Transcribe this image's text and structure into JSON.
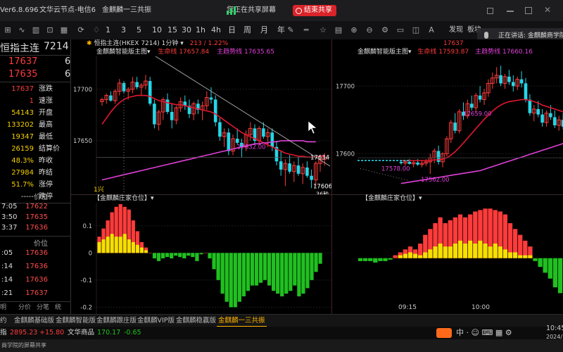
{
  "titlebar": {
    "version": "Ver6.8.696",
    "app_name": "文华云节点-电信6",
    "tab_title": "金麒麟一三共振",
    "share_status": "您正在共享屏幕",
    "end_share": "结束共享"
  },
  "toolbar": {
    "periods": [
      "1",
      "3",
      "5",
      "10",
      "15",
      "30",
      "1h",
      "4h",
      "日",
      "周",
      "月",
      "年"
    ],
    "right_items": [
      "发现",
      "板块"
    ],
    "speaking_label": "正在讲话:",
    "speaking_name": "金麒麟商学院"
  },
  "left_panel": {
    "symbol": "恒指主连",
    "symbol_code_fragment": "7214",
    "bid_price": "17637",
    "bid_fragment": "6",
    "ask_price": "17635",
    "ask_fragment": "6",
    "quote_rows": [
      {
        "value": "17637",
        "label": "涨跌",
        "color": "#ff3b3b"
      },
      {
        "value": "1",
        "label": "速涨",
        "color": "#ff3b3b"
      },
      {
        "value": "54143",
        "label": "开盘",
        "color": "#f5d000"
      },
      {
        "value": "133202",
        "label": "最高",
        "color": "#f5d000"
      },
      {
        "value": "19347",
        "label": "最低",
        "color": "#f5d000"
      },
      {
        "value": "26159",
        "label": "结算价",
        "color": "#f5d000"
      },
      {
        "value": "48.3%",
        "label": "昨收",
        "color": "#f5d000"
      },
      {
        "value": "27984",
        "label": "昨结",
        "color": "#f5d000"
      },
      {
        "value": "51.7%",
        "label": "涨停",
        "color": "#f5d000"
      },
      {
        "value": "-----",
        "label": "跌停",
        "color": "#dddddd"
      }
    ],
    "price_header": "价位",
    "trades_a": [
      {
        "time": "7:05",
        "price": "17622"
      },
      {
        "time": "3:50",
        "price": "17635"
      },
      {
        "time": "3:37",
        "price": "17636"
      }
    ],
    "price_header_2": "价位",
    "trades_b": [
      {
        "time": ":05",
        "price": "17636"
      },
      {
        "time": ":14",
        "price": "17636"
      },
      {
        "time": ":14",
        "price": "17636"
      },
      {
        "time": ":21",
        "price": "17637"
      }
    ],
    "bottom_tabs": [
      "明",
      "分价",
      "分笔",
      "统"
    ]
  },
  "chart_data": [
    {
      "type": "candlestick",
      "title": "恒指主连(HKEX 7214) 1分钟",
      "change": "213 / 1.22%",
      "main_label": "金麒麟智能版主图",
      "lifeline_label": "生命线",
      "lifeline_value": "17657.84",
      "trend_label": "主趋势线",
      "trend_value": "17635.65",
      "y_ticks": [
        17700,
        17650
      ],
      "ylim": [
        17598,
        17732
      ],
      "price_labels": [
        "17634",
        "17606"
      ],
      "countdown": "36秒",
      "annotation": "17632.00",
      "tag": "1兴",
      "candles": [
        [
          17688,
          17692,
          17684,
          17690
        ],
        [
          17690,
          17696,
          17686,
          17694
        ],
        [
          17694,
          17698,
          17688,
          17689
        ],
        [
          17689,
          17700,
          17686,
          17698
        ],
        [
          17698,
          17710,
          17694,
          17706
        ],
        [
          17706,
          17708,
          17696,
          17698
        ],
        [
          17698,
          17702,
          17690,
          17700
        ],
        [
          17700,
          17712,
          17696,
          17707
        ],
        [
          17707,
          17712,
          17700,
          17702
        ],
        [
          17702,
          17706,
          17694,
          17704
        ],
        [
          17704,
          17714,
          17700,
          17708
        ],
        [
          17708,
          17712,
          17684,
          17686
        ],
        [
          17686,
          17690,
          17662,
          17666
        ],
        [
          17666,
          17680,
          17660,
          17678
        ],
        [
          17678,
          17692,
          17670,
          17690
        ],
        [
          17690,
          17696,
          17676,
          17678
        ],
        [
          17678,
          17686,
          17662,
          17670
        ],
        [
          17670,
          17684,
          17666,
          17682
        ],
        [
          17682,
          17692,
          17678,
          17688
        ],
        [
          17688,
          17694,
          17680,
          17684
        ],
        [
          17684,
          17690,
          17672,
          17676
        ],
        [
          17676,
          17688,
          17670,
          17686
        ],
        [
          17686,
          17690,
          17676,
          17680
        ],
        [
          17680,
          17688,
          17670,
          17684
        ],
        [
          17684,
          17698,
          17680,
          17692
        ],
        [
          17692,
          17702,
          17686,
          17690
        ],
        [
          17690,
          17694,
          17664,
          17668
        ],
        [
          17668,
          17672,
          17650,
          17654
        ],
        [
          17654,
          17662,
          17644,
          17658
        ],
        [
          17658,
          17662,
          17636,
          17640
        ],
        [
          17640,
          17656,
          17636,
          17652
        ],
        [
          17652,
          17662,
          17646,
          17648
        ],
        [
          17648,
          17652,
          17634,
          17644
        ],
        [
          17644,
          17660,
          17640,
          17656
        ],
        [
          17656,
          17668,
          17650,
          17662
        ],
        [
          17662,
          17666,
          17646,
          17650
        ],
        [
          17650,
          17664,
          17646,
          17662
        ],
        [
          17662,
          17668,
          17652,
          17654
        ],
        [
          17654,
          17662,
          17644,
          17658
        ],
        [
          17658,
          17662,
          17640,
          17644
        ],
        [
          17644,
          17650,
          17626,
          17630
        ],
        [
          17630,
          17640,
          17616,
          17622
        ],
        [
          17622,
          17632,
          17606,
          17628
        ],
        [
          17628,
          17636,
          17618,
          17620
        ],
        [
          17620,
          17630,
          17610,
          17626
        ],
        [
          17626,
          17634,
          17616,
          17618
        ],
        [
          17618,
          17628,
          17608,
          17624
        ],
        [
          17624,
          17630,
          17614,
          17616
        ],
        [
          17616,
          17622,
          17604,
          17612
        ],
        [
          17612,
          17630,
          17606,
          17628
        ],
        [
          17628,
          17636,
          17620,
          17632
        ],
        [
          17632,
          17638,
          17626,
          17634
        ]
      ],
      "lifeline": [
        17666,
        17672,
        17678,
        17683,
        17687,
        17690,
        17692,
        17693,
        17694,
        17694,
        17694,
        17693,
        17691,
        17689,
        17688,
        17687,
        17686,
        17685,
        17685,
        17684,
        17683,
        17682,
        17681,
        17680,
        17679,
        17678,
        17676,
        17673,
        17670,
        17667,
        17664,
        17661,
        17658,
        17656,
        17654,
        17652,
        17650,
        17648,
        17646,
        17644,
        17642,
        17640,
        17638,
        17637,
        17636,
        17635,
        17635,
        17634,
        17634,
        17634,
        17635,
        17635
      ],
      "trendline": [
        17612,
        17613,
        17614,
        17615,
        17616,
        17617,
        17618,
        17619,
        17620,
        17621,
        17622,
        17623,
        17624,
        17625,
        17626,
        17627,
        17628,
        17629,
        17630,
        17631,
        17632,
        17633,
        17634,
        17635,
        17636,
        17637,
        17638,
        17639,
        17640,
        17641,
        17642,
        17643,
        17644,
        17645,
        17646,
        17647,
        17647,
        17648,
        17648,
        17649,
        17649,
        17650,
        17650,
        17650,
        17650,
        17650,
        17650,
        17649,
        17649,
        17649
      ]
    },
    {
      "type": "bar",
      "title": "【金麒麟庄家仓位】",
      "y_ticks": [
        0.1,
        0,
        -0.1,
        -0.2
      ],
      "ylim": [
        -0.225,
        0.185
      ],
      "values": [
        0.06,
        0.09,
        0.12,
        0.15,
        0.17,
        0.18,
        0.17,
        0.16,
        0.12,
        0.08,
        0.04,
        0.02,
        0,
        -0.02,
        -0.03,
        -0.02,
        -0.015,
        -0.02,
        -0.01,
        -0.015,
        -0.02,
        -0.01,
        -0.015,
        -0.03,
        -0.005,
        0,
        -0.02,
        -0.06,
        -0.1,
        -0.15,
        -0.18,
        -0.2,
        -0.2,
        -0.18,
        -0.16,
        -0.14,
        -0.12,
        -0.12,
        -0.11,
        -0.1,
        -0.12,
        -0.14,
        -0.15,
        -0.16,
        -0.15,
        -0.14,
        -0.12,
        -0.16,
        -0.15,
        -0.13,
        -0.1,
        -0.07,
        -0.04
      ],
      "yellow_part": [
        0.04,
        0.05,
        0.06,
        0.07,
        0.06,
        0.06,
        0.07,
        0.05,
        0.04,
        0.03,
        0.02,
        0.01
      ]
    },
    {
      "type": "candlestick",
      "main_label": "金麒麟智能版主图",
      "lifeline_label": "生命线",
      "lifeline_value": "17593.87",
      "trend_label": "主趋势线",
      "trend_value": "17660.16",
      "top_price": "17637",
      "y_ticks": [
        17700,
        17600
      ],
      "ylim": [
        17540,
        17744
      ],
      "annotations": [
        "17659.00",
        "17578.00",
        "17562.00"
      ],
      "x_labels": [
        "09:15",
        "10:00"
      ],
      "candles": [
        [
          17588,
          17590,
          17584,
          17586
        ],
        [
          17586,
          17590,
          17582,
          17588
        ],
        [
          17588,
          17592,
          17584,
          17585
        ],
        [
          17585,
          17590,
          17580,
          17587
        ],
        [
          17587,
          17592,
          17582,
          17584
        ],
        [
          17584,
          17590,
          17580,
          17586
        ],
        [
          17586,
          17592,
          17582,
          17588
        ],
        [
          17588,
          17600,
          17570,
          17594
        ],
        [
          17594,
          17608,
          17586,
          17604
        ],
        [
          17604,
          17612,
          17584,
          17588
        ],
        [
          17588,
          17602,
          17580,
          17600
        ],
        [
          17600,
          17626,
          17596,
          17622
        ],
        [
          17622,
          17650,
          17616,
          17646
        ],
        [
          17646,
          17660,
          17630,
          17634
        ],
        [
          17634,
          17666,
          17630,
          17662
        ],
        [
          17662,
          17676,
          17650,
          17656
        ],
        [
          17656,
          17680,
          17652,
          17674
        ],
        [
          17674,
          17686,
          17664,
          17668
        ],
        [
          17668,
          17690,
          17662,
          17686
        ],
        [
          17686,
          17700,
          17676,
          17680
        ],
        [
          17680,
          17696,
          17672,
          17690
        ],
        [
          17690,
          17710,
          17684,
          17704
        ],
        [
          17704,
          17720,
          17696,
          17712
        ],
        [
          17712,
          17728,
          17704,
          17716
        ],
        [
          17716,
          17730,
          17700,
          17704
        ],
        [
          17704,
          17718,
          17696,
          17714
        ],
        [
          17714,
          17724,
          17702,
          17706
        ],
        [
          17706,
          17716,
          17692,
          17700
        ],
        [
          17700,
          17714,
          17694,
          17710
        ],
        [
          17710,
          17722,
          17698,
          17704
        ],
        [
          17704,
          17712,
          17676,
          17680
        ],
        [
          17680,
          17688,
          17656,
          17660
        ],
        [
          17660,
          17672,
          17648,
          17666
        ],
        [
          17666,
          17678,
          17654,
          17658
        ],
        [
          17658,
          17666,
          17640,
          17646
        ],
        [
          17646,
          17664,
          17640,
          17660
        ],
        [
          17660,
          17672,
          17650,
          17654
        ],
        [
          17654,
          17664,
          17638,
          17642
        ],
        [
          17642,
          17656,
          17634,
          17650
        ],
        [
          17650,
          17660,
          17636,
          17640
        ]
      ],
      "lifeline": [
        17590,
        17590,
        17590,
        17590,
        17590,
        17590,
        17590,
        17590,
        17591,
        17591,
        17592,
        17594,
        17598,
        17603,
        17609,
        17616,
        17623,
        17630,
        17637,
        17644,
        17651,
        17657,
        17663,
        17668,
        17672,
        17675,
        17677,
        17678,
        17679,
        17680,
        17680,
        17679,
        17677,
        17675,
        17672,
        17670,
        17668,
        17666,
        17664,
        17662
      ],
      "trendline": [
        17556,
        17557,
        17558,
        17559,
        17560,
        17561,
        17562,
        17563,
        17564,
        17565,
        17566,
        17567,
        17568,
        17569,
        17570,
        17571,
        17572,
        17573,
        17574,
        17575,
        17577,
        17579,
        17581,
        17583,
        17585,
        17587,
        17589,
        17591,
        17593,
        17595,
        17597,
        17599,
        17601,
        17603,
        17605,
        17607,
        17609,
        17611,
        17613,
        17615
      ]
    },
    {
      "type": "bar",
      "title": "【金麒麟庄家仓位】",
      "values": [
        -0.01,
        -0.01,
        -0.01,
        -0.015,
        -0.01,
        -0.01,
        -0.005,
        0.01,
        0.02,
        0.03,
        0.04,
        0.03,
        0.05,
        0.08,
        0.1,
        0.12,
        0.14,
        0.12,
        0.13,
        0.14,
        0.15,
        0.14,
        0.15,
        0.16,
        0.165,
        0.17,
        0.17,
        0.165,
        0.16,
        0.15,
        0.12,
        0.1,
        0.08,
        0.06,
        0.04,
        -0.01,
        -0.03,
        -0.05,
        -0.07,
        -0.1,
        -0.12
      ],
      "yellow_part": [
        0,
        0,
        0,
        0,
        0,
        0,
        0,
        0,
        0.01,
        0.015,
        0.02,
        0.015,
        0.01,
        0.02,
        0.03,
        0.04,
        0.05,
        0.04,
        0.04,
        0.05,
        0.06,
        0.05,
        0.06,
        0.05,
        0.06,
        0.05,
        0.04,
        0.05,
        0.04,
        0.03,
        0.02,
        0.02,
        0.01,
        0.01,
        0.01
      ]
    }
  ],
  "bottom_tabs": [
    "约",
    "金麒麟基础版",
    "金麒麟智能版",
    "金麒麟跟庄版",
    "金麒麟VIP版",
    "金麒麟稳赢版",
    "金麒麟一三共振"
  ],
  "status_bar": {
    "left_label": "指",
    "left_price": "2895.23",
    "left_change": "+15.80",
    "mid_label": "文华商品",
    "mid_price": "170.17",
    "mid_change": "-0.65",
    "clock": "10:45",
    "date_fragment": "2024/"
  },
  "bottom_strip": {
    "text": "商学院的屏幕共享"
  },
  "colors": {
    "up": "#ff3b3b",
    "down": "#20c020",
    "lifeline": "#e3172f",
    "trendline": "#e040d8",
    "accent": "#ffb400"
  }
}
